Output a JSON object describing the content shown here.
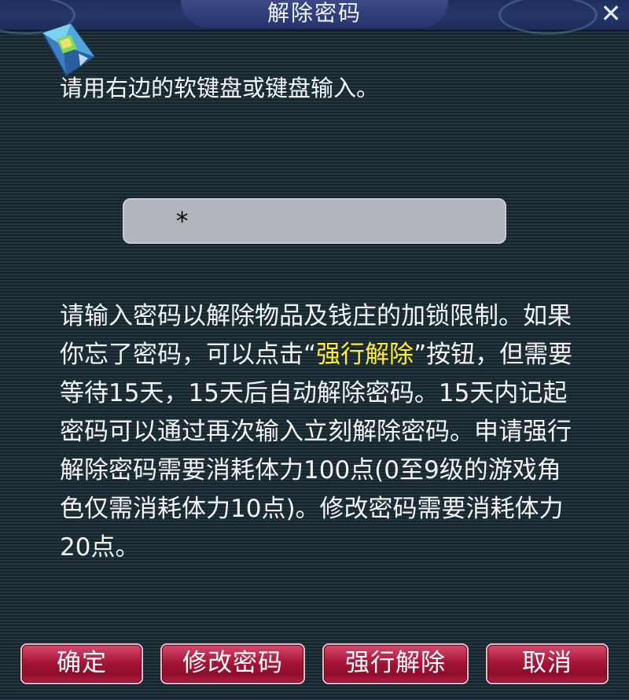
{
  "dialog": {
    "title": "解除密码",
    "close_label": "✕",
    "gem_icon": "diamond-gem-icon"
  },
  "instruction": "请用右边的软键盘或键盘输入。",
  "password": {
    "value": "*"
  },
  "description": {
    "part1": "请输入密码以解除物品及钱庄的加锁限制。如果你忘了密码，可以点击“",
    "highlight": "强行解除",
    "part2": "”按钮，但需要等待15天，15天后自动解除密码。15天内记起密码可以通过再次输入立刻解除密码。申请强行解除密码需要消耗体力100点(0至9级的游戏角色仅需消耗体力10点)。修改密码需要消耗体力20点。"
  },
  "buttons": {
    "confirm": "确定",
    "change_password": "修改密码",
    "force_unlock": "强行解除",
    "cancel": "取消"
  },
  "colors": {
    "highlight": "#ffee33",
    "button": "#a8163a",
    "background": "#1c2b34"
  }
}
